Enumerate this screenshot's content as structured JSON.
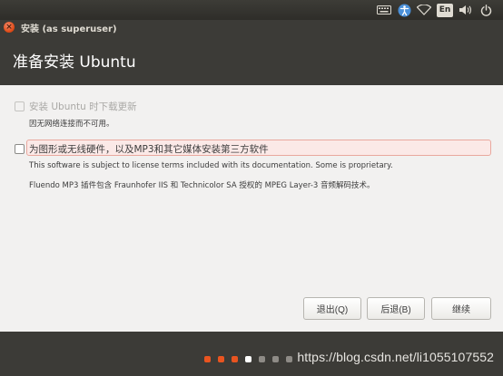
{
  "system_panel": {
    "icons": [
      "keyboard-icon",
      "accessibility-icon",
      "wifi-icon",
      "language-indicator",
      "volume-icon",
      "power-icon"
    ],
    "language": "En"
  },
  "window": {
    "title": "安装 (as superuser)"
  },
  "header": {
    "title": "准备安装 Ubuntu"
  },
  "options": {
    "download_updates": {
      "label": "安装 Ubuntu 时下载更新",
      "checked": false,
      "enabled": false,
      "note": "因无网络连接而不可用。"
    },
    "third_party": {
      "label": "为图形或无线硬件，以及MP3和其它媒体安装第三方软件",
      "checked": false,
      "enabled": true,
      "note_1": "This software is subject to license terms included with its documentation. Some is proprietary.",
      "note_2": "Fluendo MP3 插件包含 Fraunhofer IIS 和 Technicolor SA 授权的 MPEG Layer-3 音频解码技术。"
    }
  },
  "buttons": {
    "quit": "退出(Q)",
    "back": "后退(B)",
    "continue": "继续"
  },
  "progress": {
    "total_steps": 7,
    "current_step": 4,
    "colors": {
      "done": "#e95420",
      "current": "#ffffff",
      "todo": "#8e8b86"
    }
  },
  "watermark": "https://blog.csdn.net/li1055107552"
}
